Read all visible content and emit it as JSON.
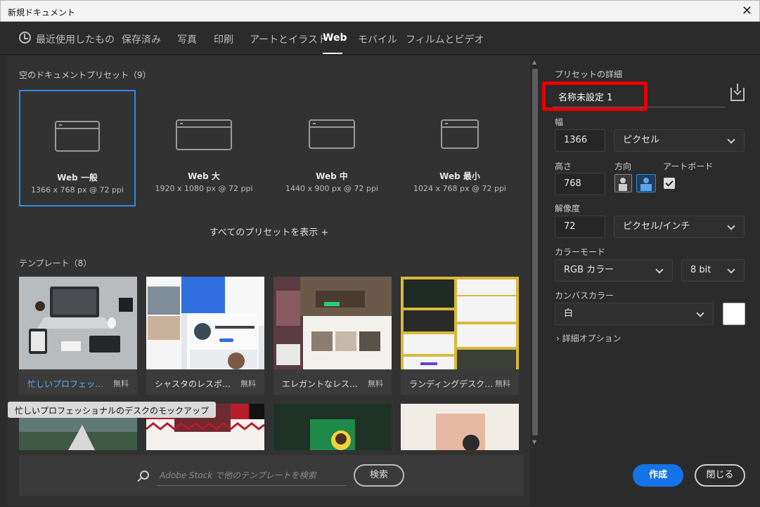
{
  "window": {
    "title": "新規ドキュメント",
    "close_label": "✕"
  },
  "tabs": [
    {
      "label": "最近使用したもの"
    },
    {
      "label": "保存済み"
    },
    {
      "label": "写真"
    },
    {
      "label": "印刷"
    },
    {
      "label": "アートとイラスト"
    },
    {
      "label": "Web"
    },
    {
      "label": "モバイル"
    },
    {
      "label": "フィルムとビデオ"
    }
  ],
  "presets_section": {
    "title": "空のドキュメントプリセット（9）",
    "show_all": "すべてのプリセットを表示 +"
  },
  "presets": [
    {
      "name": "Web 一般",
      "dims": "1366 x 768 px @ 72 ppi"
    },
    {
      "name": "Web 大",
      "dims": "1920 x 1080 px @ 72 ppi"
    },
    {
      "name": "Web 中",
      "dims": "1440 x 900 px @ 72 ppi"
    },
    {
      "name": "Web 最小",
      "dims": "1024 x 768 px @ 72 ppi"
    }
  ],
  "templates_section": {
    "title": "テンプレート（8）"
  },
  "templates": [
    {
      "caption": "忙しいプロフェッショナ...",
      "price": "無料"
    },
    {
      "caption": "シャスタのレスポンシブ...",
      "price": "無料"
    },
    {
      "caption": "エレガントなレスポンシ...",
      "price": "無料"
    },
    {
      "caption": "ランディングデスクトッ...",
      "price": "無料"
    }
  ],
  "tooltip": "忙しいプロフェッショナルのデスクのモックアップ",
  "search": {
    "placeholder": "Adobe Stock で他のテンプレートを検索",
    "button": "検索"
  },
  "details": {
    "title": "プリセットの詳細",
    "name": "名称未設定 1",
    "width_label": "幅",
    "width": "1366",
    "unit": "ピクセル",
    "height_label": "高さ",
    "height": "768",
    "orientation_label": "方向",
    "artboard_label": "アートボード",
    "resolution_label": "解像度",
    "resolution": "72",
    "resolution_unit": "ピクセル/インチ",
    "color_mode_label": "カラーモード",
    "color_mode": "RGB カラー",
    "bit_depth": "8 bit",
    "canvas_color_label": "カンバスカラー",
    "canvas_color": "白",
    "advanced": "詳細オプション"
  },
  "buttons": {
    "create": "作成",
    "close": "閉じる"
  },
  "colors": {
    "accent": "#1473e6",
    "selected_border": "#2c8be5",
    "highlight": "#e50000"
  }
}
